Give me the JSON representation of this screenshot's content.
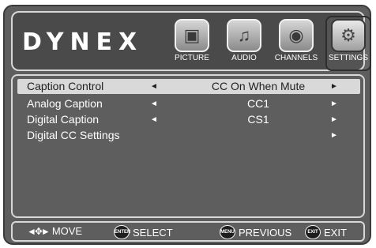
{
  "brand": "DYNEX",
  "tabs": [
    {
      "label": "PICTURE",
      "icon": "picture-icon"
    },
    {
      "label": "AUDIO",
      "icon": "audio-icon"
    },
    {
      "label": "CHANNELS",
      "icon": "channels-icon"
    },
    {
      "label": "SETTINGS",
      "icon": "settings-icon"
    }
  ],
  "active_tab": "SETTINGS",
  "menu": {
    "rows": [
      {
        "name": "Caption Control",
        "value": "CC On When Mute",
        "left_arrow": "◄",
        "right_arrow": "►"
      },
      {
        "name": "Analog Caption",
        "value": "CC1",
        "left_arrow": "◄",
        "right_arrow": "►"
      },
      {
        "name": "Digital Caption",
        "value": "CS1",
        "left_arrow": "◄",
        "right_arrow": "►"
      },
      {
        "name": "Digital CC Settings",
        "value": "",
        "left_arrow": "",
        "right_arrow": "►"
      }
    ]
  },
  "footer": {
    "move": "MOVE",
    "enter_badge": "ENTER",
    "select": "SELECT",
    "menu_badge": "MENU",
    "previous": "PREVIOUS",
    "exit_badge": "EXIT",
    "exit": "EXIT"
  }
}
